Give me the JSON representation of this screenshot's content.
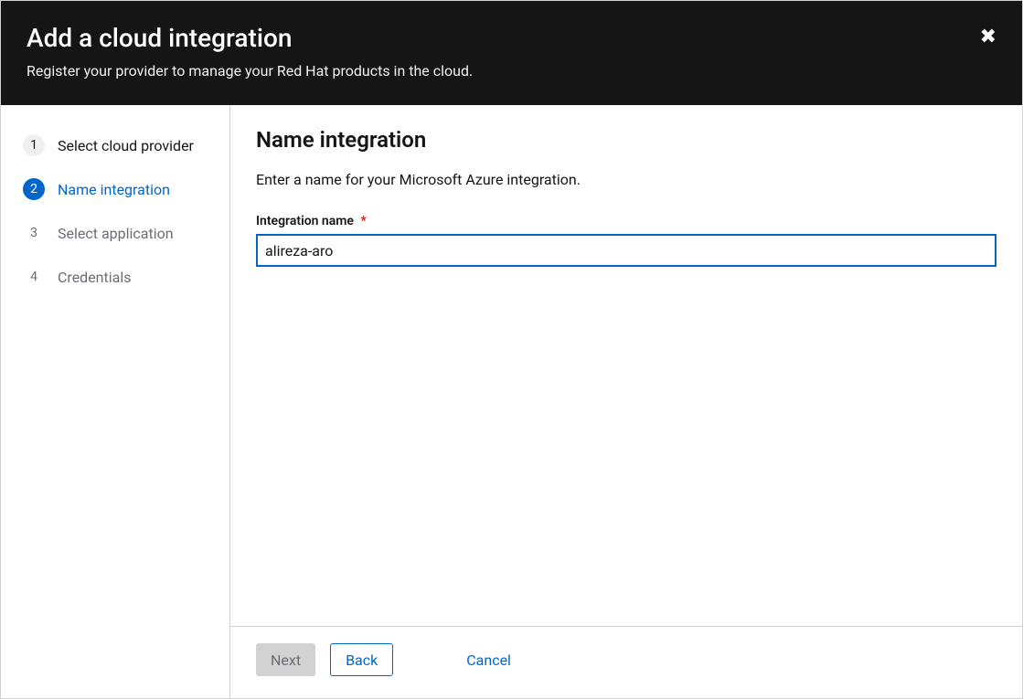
{
  "header": {
    "title": "Add a cloud integration",
    "subtitle": "Register your provider to manage your Red Hat products in the cloud."
  },
  "steps": [
    {
      "num": "1",
      "label": "Select cloud provider",
      "state": "completed"
    },
    {
      "num": "2",
      "label": "Name integration",
      "state": "active"
    },
    {
      "num": "3",
      "label": "Select application",
      "state": "pending"
    },
    {
      "num": "4",
      "label": "Credentials",
      "state": "pending"
    }
  ],
  "main": {
    "heading": "Name integration",
    "description": "Enter a name for your Microsoft Azure integration.",
    "field_label": "Integration name",
    "required_mark": "*",
    "input_value": "alireza-aro"
  },
  "footer": {
    "next": "Next",
    "back": "Back",
    "cancel": "Cancel"
  }
}
